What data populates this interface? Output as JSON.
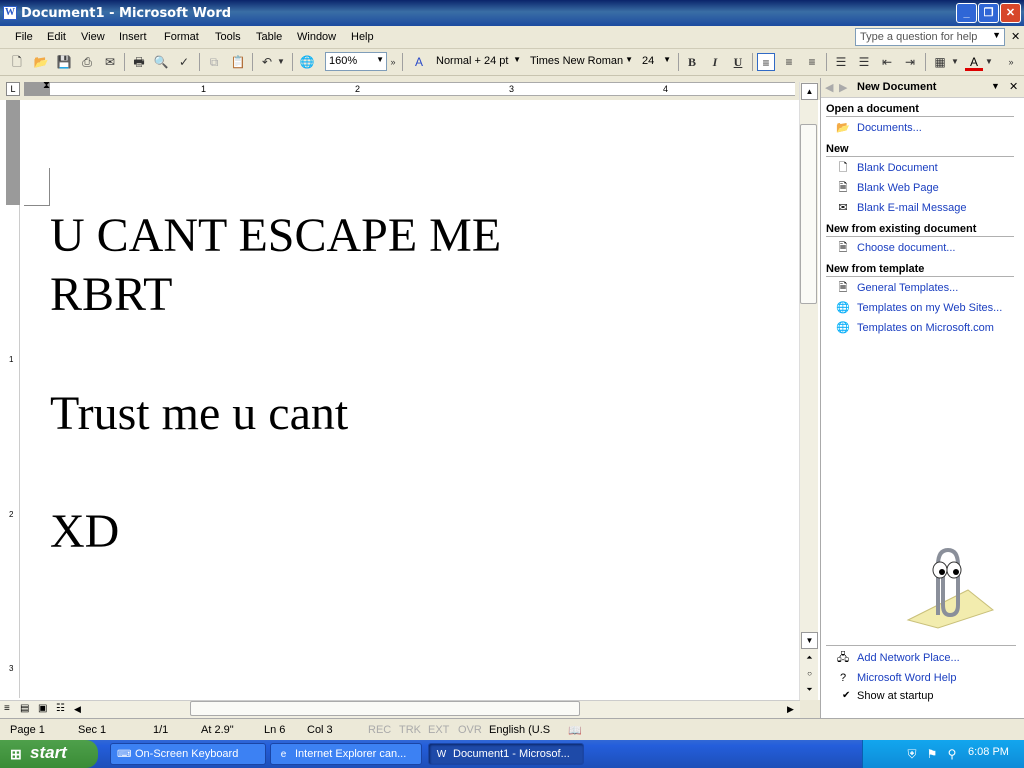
{
  "window": {
    "title": "Document1 - Microsoft Word",
    "app_icon": "W"
  },
  "menu": [
    "File",
    "Edit",
    "View",
    "Insert",
    "Format",
    "Tools",
    "Table",
    "Window",
    "Help"
  ],
  "help_box": {
    "placeholder": "Type a question for help"
  },
  "toolbar": {
    "zoom": "160%",
    "style": "Normal + 24 pt",
    "font": "Times New Roman",
    "size": "24",
    "bold": "B",
    "italic": "I",
    "underline": "U",
    "font_color_label": "A"
  },
  "ruler": {
    "marks": [
      "1",
      "2",
      "3",
      "4"
    ],
    "vmarks": [
      "1",
      "2",
      "3"
    ]
  },
  "document": {
    "lines": [
      "U CANT ESCAPE ME",
      "RBRT",
      "Trust me u cant",
      "XD"
    ]
  },
  "status": {
    "page": "Page  1",
    "sec": "Sec  1",
    "pages": "1/1",
    "at": "At  2.9\"",
    "ln": "Ln  6",
    "col": "Col  3",
    "rec": "REC",
    "trk": "TRK",
    "ext": "EXT",
    "ovr": "OVR",
    "lang": "English (U.S"
  },
  "task_pane": {
    "title": "New Document",
    "sections": [
      {
        "heading": "Open a document",
        "items": [
          "Documents..."
        ]
      },
      {
        "heading": "New",
        "items": [
          "Blank Document",
          "Blank Web Page",
          "Blank E-mail Message"
        ]
      },
      {
        "heading": "New from existing document",
        "items": [
          "Choose document..."
        ]
      },
      {
        "heading": "New from template",
        "items": [
          "General Templates...",
          "Templates on my Web Sites...",
          "Templates on Microsoft.com"
        ]
      }
    ],
    "footer": [
      "Add Network Place...",
      "Microsoft Word Help"
    ],
    "show_at_startup": "Show at startup"
  },
  "taskbar": {
    "start": "start",
    "tasks": [
      "On-Screen Keyboard",
      "Internet Explorer can...",
      "Document1 - Microsof..."
    ],
    "clock": "6:08 PM"
  }
}
